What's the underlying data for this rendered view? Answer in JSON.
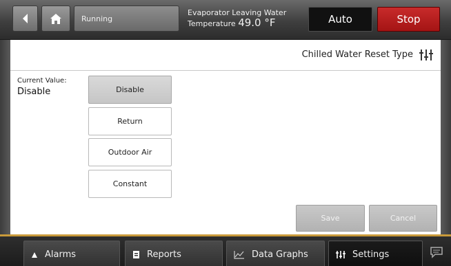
{
  "header": {
    "status": "Running",
    "evap_label": "Evaporator Leaving Water",
    "evap_temp_label": "Temperature",
    "evap_temp_value": "49.0 °F",
    "auto_label": "Auto",
    "stop_label": "Stop"
  },
  "page": {
    "title": "Chilled Water Reset Type",
    "current_value_label": "Current Value:",
    "current_value": "Disable"
  },
  "options": [
    "Disable",
    "Return",
    "Outdoor Air",
    "Constant"
  ],
  "selected_option": "Disable",
  "actions": {
    "save": "Save",
    "cancel": "Cancel"
  },
  "nav": {
    "alarms": "Alarms",
    "reports": "Reports",
    "graphs": "Data Graphs",
    "settings": "Settings"
  },
  "colors": {
    "stop": "#b71c1c",
    "accent_line": "#c99a3a"
  }
}
